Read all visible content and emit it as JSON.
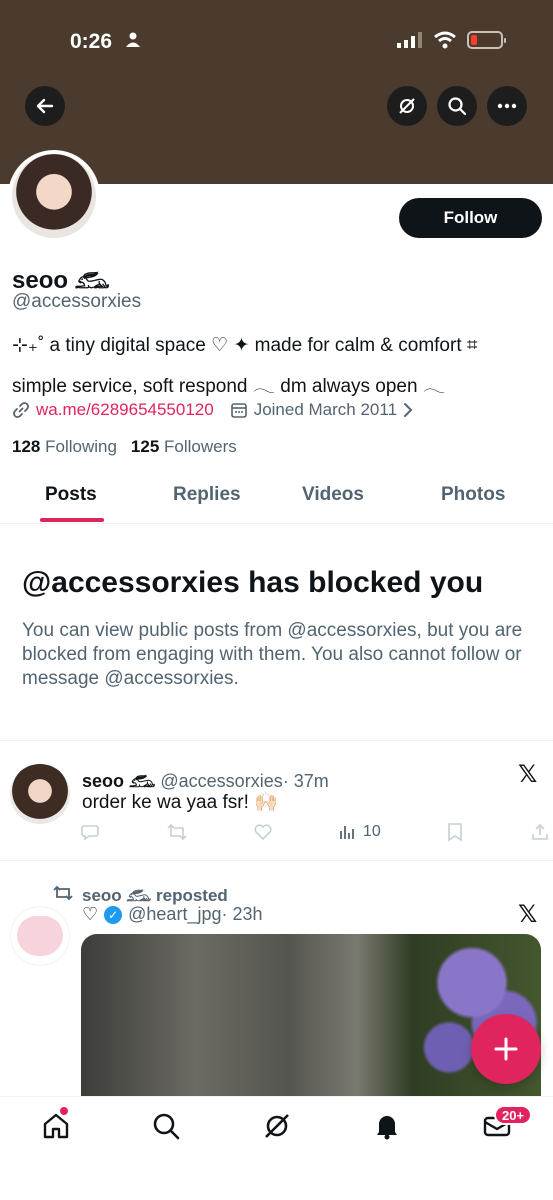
{
  "status_bar": {
    "time": "0:26"
  },
  "profile": {
    "name": "seoo 𓃹",
    "handle": "@accessorxies",
    "bio_line1": "⊹₊˚ a tiny digital space ♡ ✦ made for calm & comfort ⌗",
    "bio_line2": "simple service, soft respond 𓂃 dm always open 𓂃",
    "link": "wa.me/6289654550120",
    "joined": "Joined March 2011",
    "following_count": "128",
    "following_label": "Following",
    "followers_count": "125",
    "followers_label": "Followers",
    "follow_button": "Follow"
  },
  "tabs": [
    "Posts",
    "Replies",
    "Videos",
    "Photos"
  ],
  "blocked": {
    "title": "@accessorxies has blocked you",
    "text": "You can view public posts from @accessorxies, but you are blocked from engaging with them. You also cannot follow or message @accessorxies."
  },
  "post1": {
    "name": "seoo 𓃹",
    "handle": "@accessorxies",
    "time": "· 37m",
    "text": "order ke wa yaa fsr! 🙌🏻",
    "views": "10"
  },
  "post2": {
    "repost_label": "seoo 𓃹 reposted",
    "name": "♡",
    "handle": "@heart_jpg",
    "time": "· 23h"
  },
  "nav": {
    "badge": "20+"
  },
  "colors": {
    "accent": "#e0245e",
    "banner": "#4a3b2e"
  }
}
